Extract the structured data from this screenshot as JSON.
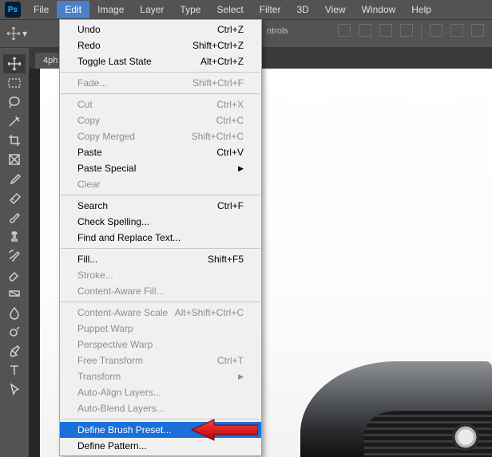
{
  "menubar": {
    "items": [
      "File",
      "Edit",
      "Image",
      "Layer",
      "Type",
      "Select",
      "Filter",
      "3D",
      "View",
      "Window",
      "Help"
    ],
    "activeIndex": 1
  },
  "optionsbar": {
    "controls_label": "ntrols"
  },
  "tab": {
    "label": "4ph"
  },
  "dropdown": {
    "rows": [
      {
        "label": "Undo",
        "shortcut": "Ctrl+Z",
        "type": "item"
      },
      {
        "label": "Redo",
        "shortcut": "Shift+Ctrl+Z",
        "type": "item"
      },
      {
        "label": "Toggle Last State",
        "shortcut": "Alt+Ctrl+Z",
        "type": "item"
      },
      {
        "type": "sep"
      },
      {
        "label": "Fade...",
        "shortcut": "Shift+Ctrl+F",
        "type": "item",
        "disabled": true
      },
      {
        "type": "sep"
      },
      {
        "label": "Cut",
        "shortcut": "Ctrl+X",
        "type": "item",
        "disabled": true
      },
      {
        "label": "Copy",
        "shortcut": "Ctrl+C",
        "type": "item",
        "disabled": true
      },
      {
        "label": "Copy Merged",
        "shortcut": "Shift+Ctrl+C",
        "type": "item",
        "disabled": true
      },
      {
        "label": "Paste",
        "shortcut": "Ctrl+V",
        "type": "item"
      },
      {
        "label": "Paste Special",
        "shortcut": "",
        "type": "submenu"
      },
      {
        "label": "Clear",
        "shortcut": "",
        "type": "item",
        "disabled": true
      },
      {
        "type": "sep"
      },
      {
        "label": "Search",
        "shortcut": "Ctrl+F",
        "type": "item"
      },
      {
        "label": "Check Spelling...",
        "shortcut": "",
        "type": "item"
      },
      {
        "label": "Find and Replace Text...",
        "shortcut": "",
        "type": "item"
      },
      {
        "type": "sep"
      },
      {
        "label": "Fill...",
        "shortcut": "Shift+F5",
        "type": "item"
      },
      {
        "label": "Stroke...",
        "shortcut": "",
        "type": "item",
        "disabled": true
      },
      {
        "label": "Content-Aware Fill...",
        "shortcut": "",
        "type": "item",
        "disabled": true
      },
      {
        "type": "sep"
      },
      {
        "label": "Content-Aware Scale",
        "shortcut": "Alt+Shift+Ctrl+C",
        "type": "item",
        "disabled": true
      },
      {
        "label": "Puppet Warp",
        "shortcut": "",
        "type": "item",
        "disabled": true
      },
      {
        "label": "Perspective Warp",
        "shortcut": "",
        "type": "item",
        "disabled": true
      },
      {
        "label": "Free Transform",
        "shortcut": "Ctrl+T",
        "type": "item",
        "disabled": true
      },
      {
        "label": "Transform",
        "shortcut": "",
        "type": "submenu",
        "disabled": true
      },
      {
        "label": "Auto-Align Layers...",
        "shortcut": "",
        "type": "item",
        "disabled": true
      },
      {
        "label": "Auto-Blend Layers...",
        "shortcut": "",
        "type": "item",
        "disabled": true
      },
      {
        "type": "sep"
      },
      {
        "label": "Define Brush Preset...",
        "shortcut": "",
        "type": "item",
        "highlight": true
      },
      {
        "label": "Define Pattern...",
        "shortcut": "",
        "type": "item"
      }
    ]
  },
  "tools": [
    "move",
    "rect-marquee",
    "lasso",
    "magic-wand",
    "crop",
    "frame",
    "eyedropper",
    "healing",
    "brush",
    "stamp",
    "history-brush",
    "eraser",
    "gradient",
    "blur",
    "dodge",
    "pen",
    "type",
    "path-select"
  ]
}
